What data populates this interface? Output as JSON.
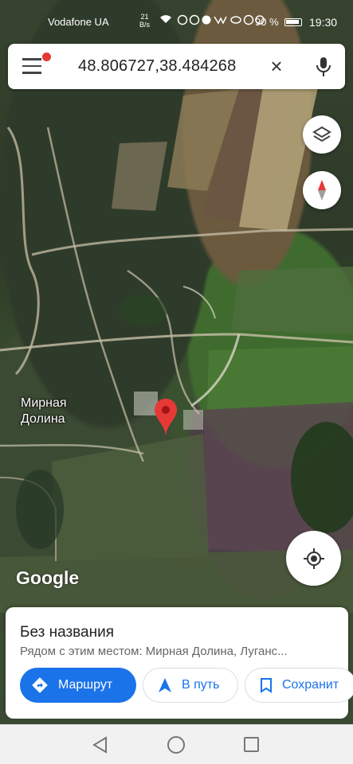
{
  "status_bar": {
    "carrier": "Vodafone UA",
    "net_speed_value": "21",
    "net_speed_unit": "B/s",
    "battery": "90 %",
    "time": "19:30"
  },
  "search": {
    "query": "48.806727,38.484268",
    "clear_symbol": "×"
  },
  "icons": {
    "menu": "hamburger-menu-icon",
    "clear": "close-icon",
    "mic": "microphone-icon",
    "layers": "layers-icon",
    "compass": "compass-icon",
    "my_location": "my-location-icon",
    "pin": "map-pin-icon"
  },
  "colors": {
    "accent": "#1a73e8",
    "pin": "#e53935",
    "notification_dot": "#e53935"
  },
  "map": {
    "place_name_line1": "Мирная",
    "place_name_line2": "Долина",
    "logo": "Google"
  },
  "place_sheet": {
    "title": "Без названия",
    "subtitle": "Рядом с этим местом: Мирная Долина, Луганс...",
    "buttons": {
      "route": "Маршрут",
      "go": "В путь",
      "save": "Сохранит"
    }
  }
}
